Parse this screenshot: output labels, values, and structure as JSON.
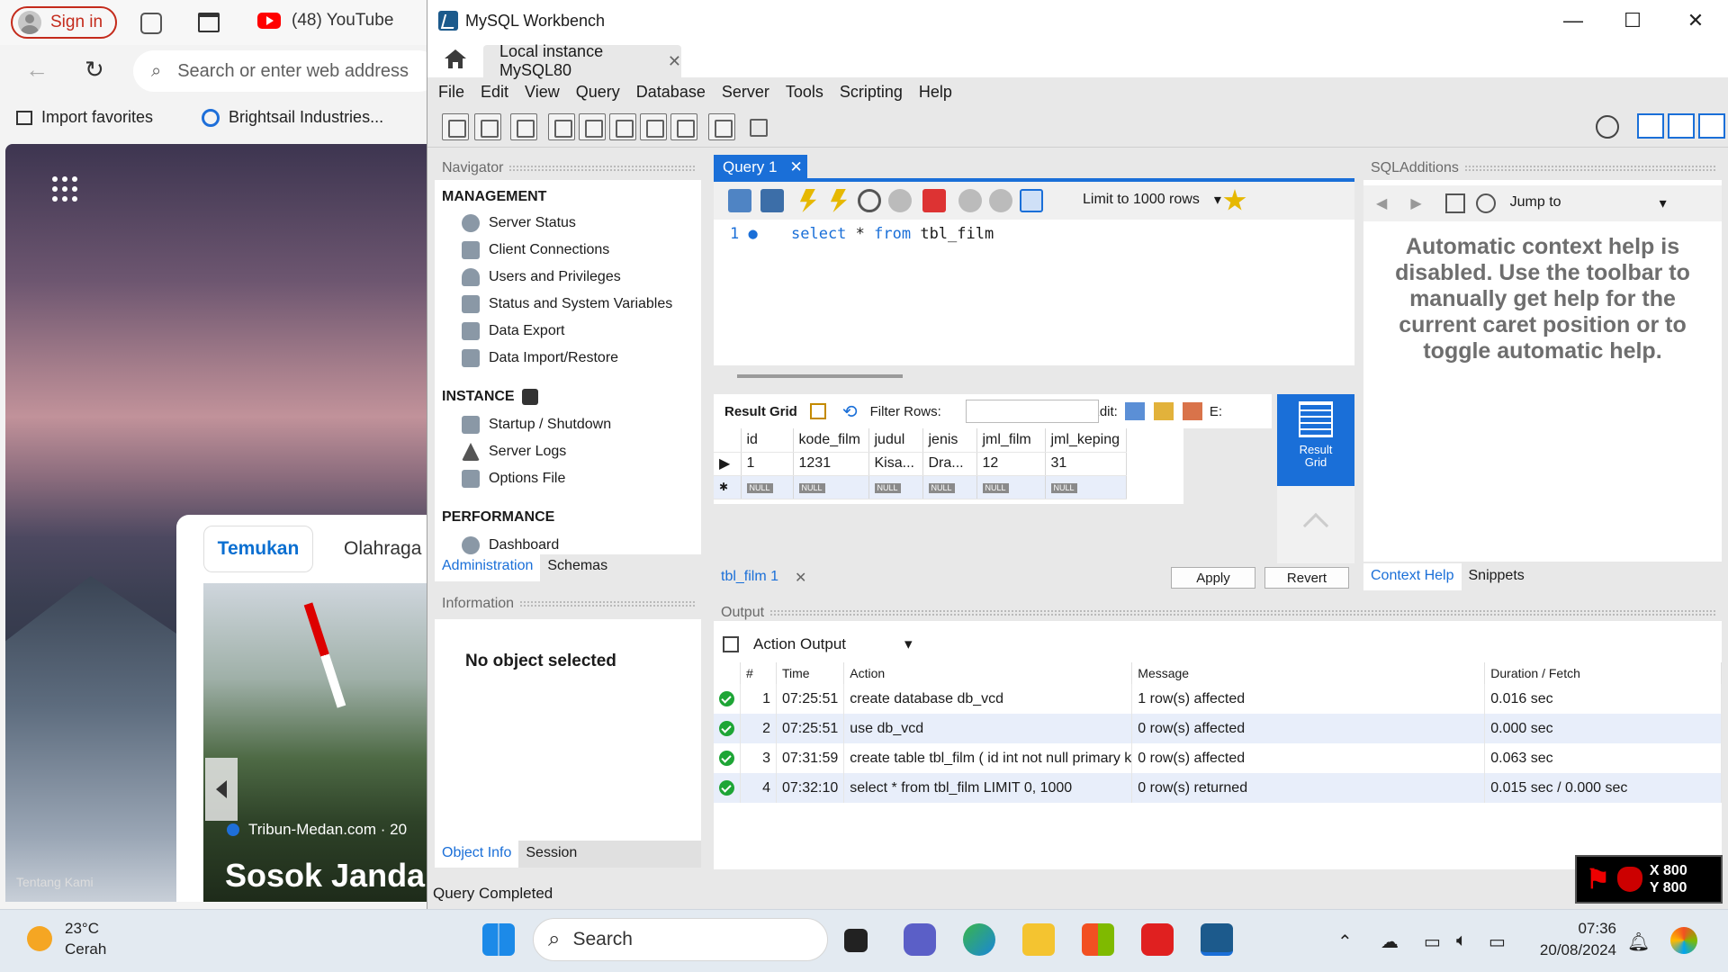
{
  "browser": {
    "sign_in": "Sign in",
    "tab_title": "(48) YouTube",
    "address_placeholder": "Search or enter web address",
    "favorites": [
      "Import favorites",
      "Brightsail Industries..."
    ],
    "feed_tabs": [
      "Temukan",
      "Olahraga"
    ],
    "news_source": "Tribun-Medan.com · 20",
    "headline": "Sosok Janda M",
    "footer_link": "Tentang Kami"
  },
  "window": {
    "title": "MySQL Workbench",
    "controls": [
      "—",
      "☐",
      "✕"
    ],
    "doc_tab": "Local instance MySQL80",
    "doc_tab_close": "✕"
  },
  "menu": [
    "File",
    "Edit",
    "View",
    "Query",
    "Database",
    "Server",
    "Tools",
    "Scripting",
    "Help"
  ],
  "navigator": {
    "title": "Navigator",
    "sections": [
      {
        "heading": "MANAGEMENT",
        "items": [
          "Server Status",
          "Client Connections",
          "Users and Privileges",
          "Status and System Variables",
          "Data Export",
          "Data Import/Restore"
        ]
      },
      {
        "heading": "INSTANCE",
        "items": [
          "Startup / Shutdown",
          "Server Logs",
          "Options File"
        ]
      },
      {
        "heading": "PERFORMANCE",
        "items": [
          "Dashboard"
        ]
      }
    ],
    "tabs": [
      "Administration",
      "Schemas"
    ]
  },
  "information": {
    "title": "Information",
    "message": "No object selected",
    "tabs": [
      "Object Info",
      "Session"
    ]
  },
  "query": {
    "tab_label": "Query 1",
    "limit_label": "Limit to 1000 rows",
    "line_number": "1",
    "sql_keyword1": "select",
    "sql_star": " * ",
    "sql_keyword2": "from",
    "sql_table": " tbl_film"
  },
  "result": {
    "label": "Result Grid",
    "filter_label": "Filter Rows:",
    "edit_label": "Edit:",
    "export_label": "E:",
    "columns": [
      "id",
      "kode_film",
      "judul",
      "jenis",
      "jml_film",
      "jml_keping"
    ],
    "row": [
      "1",
      "1231",
      "Kisa...",
      "Dra...",
      "12",
      "31"
    ],
    "null_label": "NULL",
    "side_label1": "Result",
    "side_label2": "Grid",
    "bottom_tab": "tbl_film 1",
    "apply": "Apply",
    "revert": "Revert"
  },
  "sql_additions": {
    "title": "SQLAdditions",
    "jump_to": "Jump to",
    "help_text": "Automatic context help is disabled. Use the toolbar to manually get help for the current caret position or to toggle automatic help.",
    "tabs": [
      "Context Help",
      "Snippets"
    ]
  },
  "output": {
    "title": "Output",
    "selector": "Action Output",
    "headers": [
      "#",
      "Time",
      "Action",
      "Message",
      "Duration / Fetch"
    ],
    "rows": [
      {
        "n": "1",
        "time": "07:25:51",
        "action": "create database db_vcd",
        "message": "1 row(s) affected",
        "duration": "0.016 sec"
      },
      {
        "n": "2",
        "time": "07:25:51",
        "action": "use db_vcd",
        "message": "0 row(s) affected",
        "duration": "0.000 sec"
      },
      {
        "n": "3",
        "time": "07:31:59",
        "action": "create table tbl_film ( id int not null primary key auto_...",
        "message": "0 row(s) affected",
        "duration": "0.063 sec"
      },
      {
        "n": "4",
        "time": "07:32:10",
        "action": "select * from tbl_film LIMIT 0, 1000",
        "message": "0 row(s) returned",
        "duration": "0.015 sec / 0.000 sec"
      }
    ],
    "status_color": "#1ea536"
  },
  "statusbar": "Query Completed",
  "overlay": {
    "x": "X 800",
    "y": "Y 800"
  },
  "taskbar": {
    "temp": "23°C",
    "condition": "Cerah",
    "search": "Search",
    "time": "07:36",
    "date": "20/08/2024"
  },
  "colors": {
    "accent": "#1a6fd8",
    "brand_red": "#c42b1c"
  }
}
